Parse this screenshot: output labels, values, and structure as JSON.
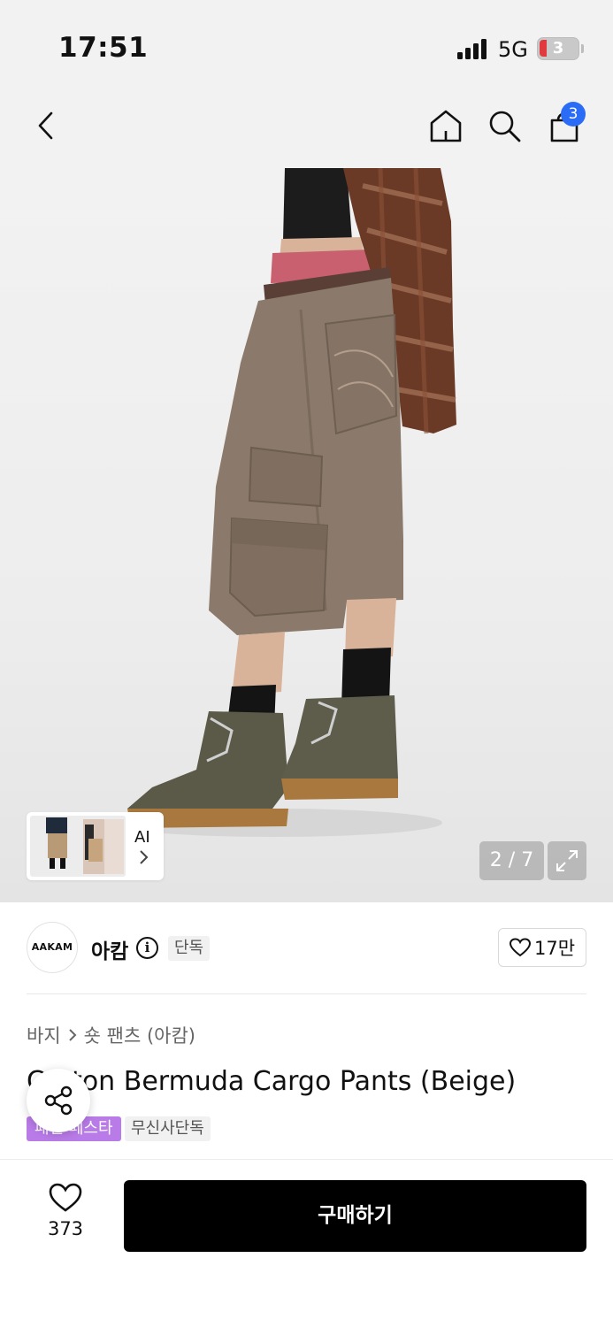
{
  "status_bar": {
    "time": "17:51",
    "network": "5G",
    "battery_text": "3",
    "battery_level_percent": 3
  },
  "header": {
    "cart_count": "3"
  },
  "gallery": {
    "ai_label": "AI",
    "page_indicator": "2 / 7",
    "current_page": 2,
    "total_pages": 7
  },
  "brand": {
    "logo_text": "AAKAM",
    "name": "아캄",
    "exclusive_tag": "단독",
    "likes": "17만"
  },
  "product": {
    "breadcrumb": [
      "바지",
      "숏 팬츠 (아캄)"
    ],
    "title": "Cotton Bermuda Cargo Pants (Beige)",
    "tags": [
      "패션 페스타",
      "무신사단독"
    ]
  },
  "bottom_bar": {
    "wish_count": "373",
    "buy_label": "구매하기"
  },
  "colors": {
    "accent_blue": "#2b6cf6",
    "festa_purple": "#b97be8",
    "buy_button": "#000000"
  }
}
